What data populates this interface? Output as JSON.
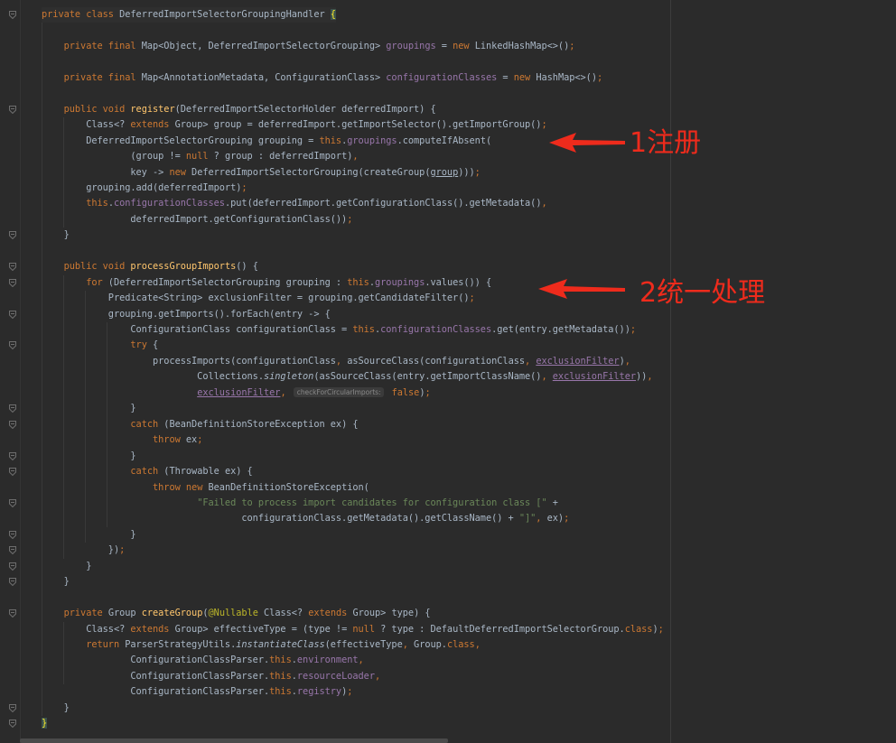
{
  "editor": {
    "lines": [
      [
        [
          "kw",
          "private class "
        ],
        [
          "",
          "DeferredImportSelectorGroupingHandler "
        ],
        [
          "bm",
          "{"
        ]
      ],
      [],
      [
        [
          "",
          "    "
        ],
        [
          "kw",
          "private final "
        ],
        [
          "",
          "Map<Object, DeferredImportSelectorGrouping> "
        ],
        [
          "fld",
          "groupings"
        ],
        [
          "",
          " = "
        ],
        [
          "kw",
          "new "
        ],
        [
          "",
          "LinkedHashMap<>()"
        ],
        [
          "kw",
          ";"
        ]
      ],
      [],
      [
        [
          "",
          "    "
        ],
        [
          "kw",
          "private final "
        ],
        [
          "",
          "Map<AnnotationMetadata, ConfigurationClass> "
        ],
        [
          "fld",
          "configurationClasses"
        ],
        [
          "",
          " = "
        ],
        [
          "kw",
          "new "
        ],
        [
          "",
          "HashMap<>()"
        ],
        [
          "kw",
          ";"
        ]
      ],
      [],
      [
        [
          "",
          "    "
        ],
        [
          "kw",
          "public void "
        ],
        [
          "fn",
          "register"
        ],
        [
          "",
          "(DeferredImportSelectorHolder deferredImport) {"
        ]
      ],
      [
        [
          "",
          "        Class<? "
        ],
        [
          "kw",
          "extends "
        ],
        [
          "",
          "Group> group = deferredImport.getImportSelector().getImportGroup()"
        ],
        [
          "kw",
          ";"
        ]
      ],
      [
        [
          "",
          "        DeferredImportSelectorGrouping grouping = "
        ],
        [
          "kw",
          "this"
        ],
        [
          "",
          "."
        ],
        [
          "fld",
          "groupings"
        ],
        [
          "",
          ".computeIfAbsent("
        ]
      ],
      [
        [
          "",
          "                (group != "
        ],
        [
          "kw",
          "null "
        ],
        [
          "",
          "? group : deferredImport)"
        ],
        [
          "kw",
          ","
        ]
      ],
      [
        [
          "",
          "                key -> "
        ],
        [
          "kw",
          "new "
        ],
        [
          "",
          "DeferredImportSelectorGrouping(createGroup("
        ],
        [
          "un",
          "group"
        ],
        [
          "",
          ")))"
        ],
        [
          "kw",
          ";"
        ]
      ],
      [
        [
          "",
          "        grouping.add(deferredImport)"
        ],
        [
          "kw",
          ";"
        ]
      ],
      [
        [
          "",
          "        "
        ],
        [
          "kw",
          "this"
        ],
        [
          "",
          "."
        ],
        [
          "fld",
          "configurationClasses"
        ],
        [
          "",
          ".put(deferredImport.getConfigurationClass().getMetadata()"
        ],
        [
          "kw",
          ","
        ]
      ],
      [
        [
          "",
          "                deferredImport.getConfigurationClass())"
        ],
        [
          "kw",
          ";"
        ]
      ],
      [
        [
          "",
          "    }"
        ]
      ],
      [],
      [
        [
          "",
          "    "
        ],
        [
          "kw",
          "public void "
        ],
        [
          "fn",
          "processGroupImports"
        ],
        [
          "",
          "() {"
        ]
      ],
      [
        [
          "",
          "        "
        ],
        [
          "kw",
          "for "
        ],
        [
          "",
          "(DeferredImportSelectorGrouping grouping : "
        ],
        [
          "kw",
          "this"
        ],
        [
          "",
          "."
        ],
        [
          "fld",
          "groupings"
        ],
        [
          "",
          ".values()) {"
        ]
      ],
      [
        [
          "",
          "            Predicate<String> exclusionFilter = grouping.getCandidateFilter()"
        ],
        [
          "kw",
          ";"
        ]
      ],
      [
        [
          "",
          "            grouping.getImports().forEach(entry -> {"
        ]
      ],
      [
        [
          "",
          "                ConfigurationClass configurationClass = "
        ],
        [
          "kw",
          "this"
        ],
        [
          "",
          "."
        ],
        [
          "fld",
          "configurationClasses"
        ],
        [
          "",
          ".get(entry.getMetadata())"
        ],
        [
          "kw",
          ";"
        ]
      ],
      [
        [
          "",
          "                "
        ],
        [
          "kw",
          "try "
        ],
        [
          "",
          "{"
        ]
      ],
      [
        [
          "",
          "                    processImports(configurationClass"
        ],
        [
          "kw",
          ", "
        ],
        [
          "",
          "asSourceClass(configurationClass"
        ],
        [
          "kw",
          ", "
        ],
        [
          "fldun",
          "exclusionFilter"
        ],
        [
          "",
          ")"
        ],
        [
          "kw",
          ","
        ]
      ],
      [
        [
          "",
          "                            Collections."
        ],
        [
          "it",
          "singleton"
        ],
        [
          "",
          "(asSourceClass(entry.getImportClassName()"
        ],
        [
          "kw",
          ", "
        ],
        [
          "fldun",
          "exclusionFilter"
        ],
        [
          "",
          "))"
        ],
        [
          "kw",
          ","
        ]
      ],
      [
        [
          "",
          "                            "
        ],
        [
          "fldun",
          "exclusionFilter"
        ],
        [
          "kw",
          ", "
        ],
        [
          "hint",
          "checkForCircularImports:"
        ],
        [
          "kw",
          " false"
        ],
        [
          "",
          ")"
        ],
        [
          "kw",
          ";"
        ]
      ],
      [
        [
          "",
          "                }"
        ]
      ],
      [
        [
          "",
          "                "
        ],
        [
          "kw",
          "catch "
        ],
        [
          "",
          "(BeanDefinitionStoreException ex) {"
        ]
      ],
      [
        [
          "",
          "                    "
        ],
        [
          "kw",
          "throw "
        ],
        [
          "",
          "ex"
        ],
        [
          "kw",
          ";"
        ]
      ],
      [
        [
          "",
          "                }"
        ]
      ],
      [
        [
          "",
          "                "
        ],
        [
          "kw",
          "catch "
        ],
        [
          "",
          "(Throwable ex) {"
        ]
      ],
      [
        [
          "",
          "                    "
        ],
        [
          "kw",
          "throw new "
        ],
        [
          "",
          "BeanDefinitionStoreException("
        ]
      ],
      [
        [
          "",
          "                            "
        ],
        [
          "str",
          "\"Failed to process import candidates for configuration class [\" "
        ],
        [
          "",
          "+"
        ]
      ],
      [
        [
          "",
          "                                    configurationClass.getMetadata().getClassName() + "
        ],
        [
          "str",
          "\"]\""
        ],
        [
          "kw",
          ", "
        ],
        [
          "",
          "ex)"
        ],
        [
          "kw",
          ";"
        ]
      ],
      [
        [
          "",
          "                }"
        ]
      ],
      [
        [
          "",
          "            })"
        ],
        [
          "kw",
          ";"
        ]
      ],
      [
        [
          "",
          "        }"
        ]
      ],
      [
        [
          "",
          "    }"
        ]
      ],
      [],
      [
        [
          "",
          "    "
        ],
        [
          "kw",
          "private "
        ],
        [
          "",
          "Group "
        ],
        [
          "fn",
          "createGroup"
        ],
        [
          "",
          "("
        ],
        [
          "ann",
          "@Nullable "
        ],
        [
          "",
          "Class<? "
        ],
        [
          "kw",
          "extends "
        ],
        [
          "",
          "Group> type) {"
        ]
      ],
      [
        [
          "",
          "        Class<? "
        ],
        [
          "kw",
          "extends "
        ],
        [
          "",
          "Group> effectiveType = (type != "
        ],
        [
          "kw",
          "null "
        ],
        [
          "",
          "? type : DefaultDeferredImportSelectorGroup."
        ],
        [
          "kw",
          "class"
        ],
        [
          "",
          ")"
        ],
        [
          "kw",
          ";"
        ]
      ],
      [
        [
          "",
          "        "
        ],
        [
          "kw",
          "return "
        ],
        [
          "",
          "ParserStrategyUtils."
        ],
        [
          "it",
          "instantiateClass"
        ],
        [
          "",
          "(effectiveType"
        ],
        [
          "kw",
          ", "
        ],
        [
          "",
          "Group."
        ],
        [
          "kw",
          "class,"
        ]
      ],
      [
        [
          "",
          "                ConfigurationClassParser."
        ],
        [
          "kw",
          "this"
        ],
        [
          "",
          "."
        ],
        [
          "fld",
          "environment"
        ],
        [
          "kw",
          ","
        ]
      ],
      [
        [
          "",
          "                ConfigurationClassParser."
        ],
        [
          "kw",
          "this"
        ],
        [
          "",
          "."
        ],
        [
          "fld",
          "resourceLoader"
        ],
        [
          "kw",
          ","
        ]
      ],
      [
        [
          "",
          "                ConfigurationClassParser."
        ],
        [
          "kw",
          "this"
        ],
        [
          "",
          "."
        ],
        [
          "fld",
          "registry"
        ],
        [
          "",
          ")"
        ],
        [
          "kw",
          ";"
        ]
      ],
      [
        [
          "",
          "    }"
        ]
      ],
      [
        [
          "bm",
          "}"
        ]
      ]
    ]
  },
  "annotations": {
    "note1": "1注册",
    "note2": "2统一处理",
    "color": "#ee2b1c"
  },
  "colors": {
    "background": "#2b2b2b",
    "text": "#a9b7c6",
    "keyword": "#cc7832",
    "field": "#9876aa",
    "method": "#ffc66d",
    "string": "#6a8759",
    "annotation": "#bbb529"
  }
}
